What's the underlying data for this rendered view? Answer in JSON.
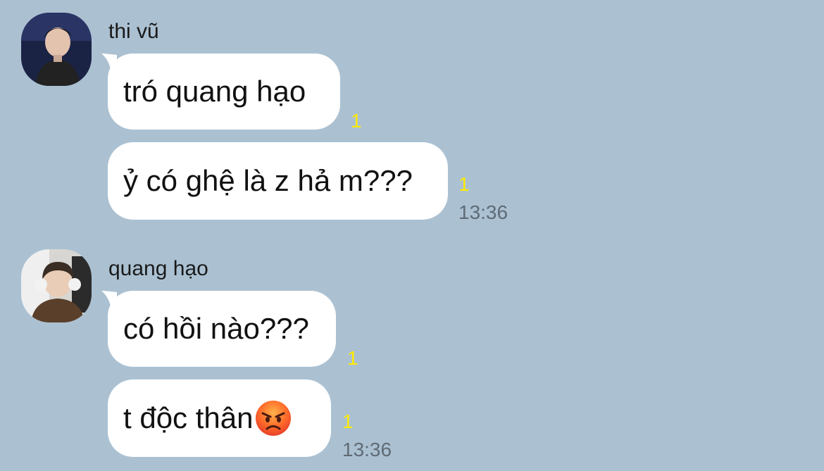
{
  "messages": [
    {
      "sender": "thi vũ",
      "avatar_icon": "avatar-photo-thi-vu",
      "bubbles": [
        {
          "text": "tró quang hạo",
          "read_count": "1"
        },
        {
          "text": "ỷ có ghệ là z hả m???",
          "read_count": "1",
          "time": "13:36"
        }
      ]
    },
    {
      "sender": "quang hạo",
      "avatar_icon": "avatar-photo-quang-hao",
      "bubbles": [
        {
          "text": "có hồi nào???",
          "read_count": "1"
        },
        {
          "text": "t độc thân",
          "emoji": "angry-face-emoji",
          "read_count": "1",
          "time": "13:36"
        }
      ]
    }
  ],
  "colors": {
    "background": "#abc1d2",
    "bubble": "#ffffff",
    "read_count": "#ffeb00",
    "time": "#5f6b75"
  }
}
